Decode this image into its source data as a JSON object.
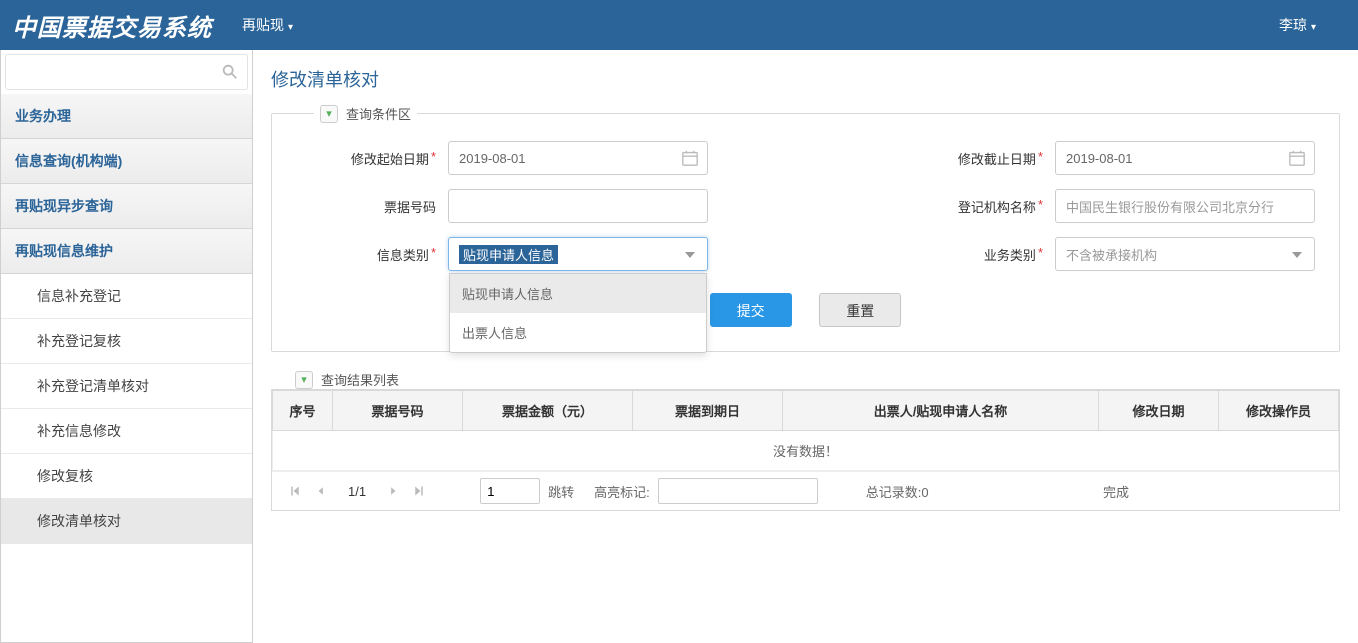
{
  "header": {
    "system_title": "中国票据交易系统",
    "nav_item": "再贴现",
    "username": "李琼"
  },
  "sidebar": {
    "groups": [
      {
        "label": "业务办理"
      },
      {
        "label": "信息查询(机构端)"
      },
      {
        "label": "再贴现异步查询"
      },
      {
        "label": "再贴现信息维护",
        "expanded": true
      }
    ],
    "items": [
      {
        "label": "信息补充登记"
      },
      {
        "label": "补充登记复核"
      },
      {
        "label": "补充登记清单核对"
      },
      {
        "label": "补充信息修改"
      },
      {
        "label": "修改复核"
      },
      {
        "label": "修改清单核对",
        "active": true
      }
    ]
  },
  "page": {
    "title": "修改清单核对"
  },
  "panels": {
    "query": "查询条件区",
    "result": "查询结果列表"
  },
  "form": {
    "start_date": {
      "label": "修改起始日期",
      "value": "2019-08-01"
    },
    "end_date": {
      "label": "修改截止日期",
      "value": "2019-08-01"
    },
    "bill_no": {
      "label": "票据号码",
      "value": ""
    },
    "org_name": {
      "label": "登记机构名称",
      "value": "中国民生银行股份有限公司北京分行"
    },
    "info_type": {
      "label": "信息类别",
      "value": "贴现申请人信息",
      "options": [
        "贴现申请人信息",
        "出票人信息"
      ]
    },
    "biz_type": {
      "label": "业务类别",
      "value": "不含被承接机构"
    }
  },
  "buttons": {
    "submit": "提交",
    "reset": "重置",
    "jump": "跳转"
  },
  "table": {
    "columns": [
      "序号",
      "票据号码",
      "票据金额（元）",
      "票据到期日",
      "出票人/贴现申请人名称",
      "修改日期",
      "修改操作员"
    ],
    "nodata": "没有数据！"
  },
  "pager": {
    "page_display": "1/1",
    "page_input": "1",
    "highlight_label": "高亮标记:",
    "total_label": "总记录数:0",
    "status": "完成"
  }
}
